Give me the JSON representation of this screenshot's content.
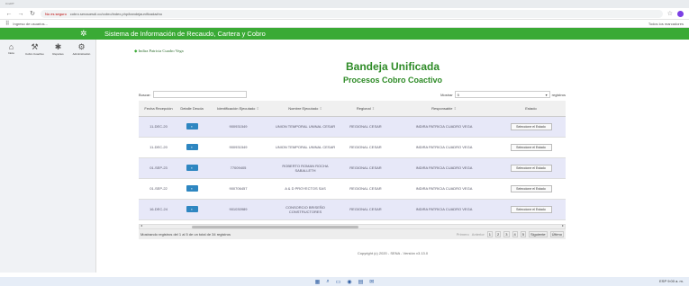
{
  "browser": {
    "tab_text": "Cmd/IT",
    "warning": "No es seguro",
    "url": "cobro.senauesdi.co/cobro/index.php/bandejaunificada#no",
    "bookmark": "Ingreso de usuarios...",
    "right_bookmarks": "Todos los marcadores"
  },
  "header": {
    "title": "Sistema de Información de Recaudo, Cartera y Cobro"
  },
  "sidebar": {
    "items": [
      {
        "label": "Inicio"
      },
      {
        "label": "Cobro Coactivo"
      },
      {
        "label": "Reportes"
      },
      {
        "label": "Administración"
      }
    ]
  },
  "user": {
    "name": "Indira Patricia Cuadro Vega"
  },
  "main": {
    "title": "Bandeja Unificada",
    "subtitle": "Procesos Cobro Coactivo"
  },
  "controls": {
    "search_label": "Buscar:",
    "show_label": "Mostrar",
    "show_value": "5",
    "registros_label": "registros"
  },
  "table": {
    "headers": [
      "Fecha Recepción",
      "Detalle Deuda",
      "Identificación Ejecutado",
      "Nombre Ejecutado",
      "Regional",
      "Responsable",
      "Estado"
    ],
    "rows": [
      {
        "fecha": "11-DEC-20",
        "id": "900931549",
        "nombre": "UNION TEMPORAL UNINAL CESAR",
        "regional": "REGIONAL CESAR",
        "responsable": "INDIRA PATRICIA CUADRO VEGA",
        "estado": "Seleccione el Estado"
      },
      {
        "fecha": "11-DEC-20",
        "id": "900931549",
        "nombre": "UNION TEMPORAL UNINAL CESAR",
        "regional": "REGIONAL CESAR",
        "responsable": "INDIRA PATRICIA CUADRO VEGA",
        "estado": "Seleccione el Estado"
      },
      {
        "fecha": "01-SEP-23",
        "id": "77009405",
        "nombre": "ROBERTO ROMAN ROCHA SABALLETH",
        "regional": "REGIONAL CESAR",
        "responsable": "INDIRA PATRICIA CUADRO VEGA",
        "estado": "Seleccione el Estado"
      },
      {
        "fecha": "01-SEP-22",
        "id": "900706457",
        "nombre": "A & D PROYECTOS SAS",
        "regional": "REGIONAL CESAR",
        "responsable": "INDIRA PATRICIA CUADRO VEGA",
        "estado": "Seleccione el Estado"
      },
      {
        "fecha": "16-DEC-24",
        "id": "901030989",
        "nombre": "CONSORCIO BRISEÑO CONSTRUCTORES",
        "regional": "REGIONAL CESAR",
        "responsable": "INDIRA PATRICIA CUADRO VEGA",
        "estado": "Seleccione el Estado"
      }
    ]
  },
  "footer": {
    "info": "Mostrando registros del 1 al 5 de un total de 34 registros",
    "primero": "Primero",
    "anterior": "Anterior",
    "pages": [
      "1",
      "2",
      "3",
      "4",
      "5"
    ],
    "siguiente": "Siguiente",
    "ultimo": "Último"
  },
  "copyright": "Copyright (c) 2020 - SENA - Versión v3.13.0",
  "tray": {
    "text": "ESP",
    "time": "9:00 a. m."
  }
}
